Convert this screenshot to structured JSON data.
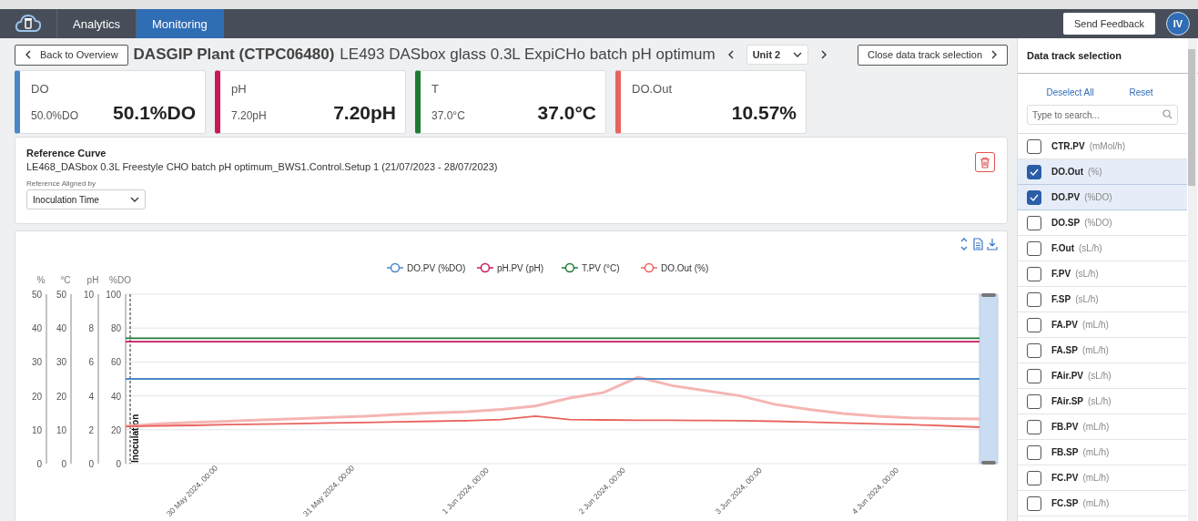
{
  "nav": {
    "tabs": [
      {
        "label": "Analytics",
        "selected": false
      },
      {
        "label": "Monitoring",
        "selected": true
      }
    ],
    "feedback_button": "Send Feedback",
    "avatar": "IV"
  },
  "header": {
    "back_button": "Back to Overview",
    "plant": "DASGIP Plant (CTPC06480)",
    "run": "LE493 DASbox glass 0.3L ExpiCHo batch pH optimum",
    "unit_select": "Unit 2",
    "close_button": "Close data track selection"
  },
  "cards": [
    {
      "label": "DO",
      "setpoint": "50.0%DO",
      "value": "50.1%DO",
      "color": "#4a86c8"
    },
    {
      "label": "pH",
      "setpoint": "7.20pH",
      "value": "7.20pH",
      "color": "#c8185a"
    },
    {
      "label": "T",
      "setpoint": "37.0°C",
      "value": "37.0°C",
      "color": "#1e7b34"
    },
    {
      "label": "DO.Out",
      "value": "10.57%",
      "color": "#e8635e"
    }
  ],
  "reference": {
    "title": "Reference Curve",
    "name": "LE468_DASbox 0.3L Freestyle CHO batch pH optimum_BWS1.Control.Setup 1 (21/07/2023 - 28/07/2023)",
    "aligned_label": "Reference Aligned by",
    "aligned_value": "Inoculation Time"
  },
  "chart": {
    "secondary_axes": [
      {
        "title": "%",
        "ticks": [
          "50",
          "40",
          "30",
          "20",
          "10",
          "0"
        ]
      },
      {
        "title": "°C",
        "ticks": [
          "50",
          "40",
          "30",
          "20",
          "10",
          "0"
        ]
      },
      {
        "title": "pH",
        "ticks": [
          "10",
          "8",
          "6",
          "4",
          "2",
          "0"
        ]
      }
    ],
    "chart_data": {
      "type": "line",
      "ylabel": "%DO",
      "categories": [
        null,
        null,
        "30 May 2024, 00:00",
        null,
        null,
        null,
        "31 May 2024, 00:00",
        null,
        null,
        null,
        "1 Jun 2024, 00:00",
        null,
        null,
        null,
        "2 Jun 2024, 00:00",
        null,
        null,
        null,
        "3 Jun 2024, 00:00",
        null,
        null,
        null,
        "4 Jun 2024, 00:00",
        null,
        null,
        null
      ],
      "yticks": [
        0,
        20,
        40,
        60,
        80,
        100
      ],
      "ylim": [
        0,
        100
      ],
      "grid": true,
      "legend": "top",
      "series": [
        {
          "name": "DO.PV (%DO)",
          "color": "#4a86c8",
          "values": [
            50,
            50,
            50,
            50,
            50,
            50,
            50,
            50,
            50,
            50,
            50,
            50,
            50,
            50,
            50,
            50,
            50,
            50,
            50,
            50,
            50,
            50,
            50,
            50,
            50,
            50
          ]
        },
        {
          "name": "pH.PV (pH)",
          "color": "#c8185a",
          "values": [
            72,
            72,
            72,
            72,
            72,
            72,
            72,
            72,
            72,
            72,
            72,
            72,
            72,
            72,
            72,
            72,
            72,
            72,
            72,
            72,
            72,
            72,
            72,
            72,
            72,
            72
          ]
        },
        {
          "name": "T.PV (°C)",
          "color": "#1e7b34",
          "values": [
            74,
            74,
            74,
            74,
            74,
            74,
            74,
            74,
            74,
            74,
            74,
            74,
            74,
            74,
            74,
            74,
            74,
            74,
            74,
            74,
            74,
            74,
            74,
            74,
            74,
            74
          ]
        },
        {
          "name": "DO.Out (%)",
          "color": "#e8635e",
          "values": [
            22,
            22.3,
            22.6,
            23,
            23.3,
            23.6,
            24,
            24.3,
            24.6,
            25,
            25.3,
            26,
            28,
            26,
            25.8,
            25.6,
            25.6,
            25.5,
            25.3,
            25,
            24.5,
            24,
            23.5,
            23,
            22.3,
            21.5
          ]
        },
        {
          "color": "#f5b5b2",
          "values": [
            22,
            23.5,
            24.3,
            25,
            25.8,
            26.5,
            27.3,
            28,
            29,
            30,
            30.6,
            32,
            34,
            38.7,
            42,
            51,
            46,
            43,
            40,
            35,
            32,
            29.6,
            28,
            27,
            26.6,
            26.3
          ]
        }
      ],
      "annotations": [
        "Inoculation"
      ]
    }
  },
  "track_panel": {
    "title": "Data track selection",
    "deselect_all": "Deselect All",
    "reset": "Reset",
    "search_placeholder": "Type to search...",
    "tracks": [
      {
        "name": "CTR.PV",
        "unit": "(mMol/h)",
        "checked": false
      },
      {
        "name": "DO.Out",
        "unit": "(%)",
        "checked": true
      },
      {
        "name": "DO.PV",
        "unit": "(%DO)",
        "checked": true
      },
      {
        "name": "DO.SP",
        "unit": "(%DO)",
        "checked": false
      },
      {
        "name": "F.Out",
        "unit": "(sL/h)",
        "checked": false
      },
      {
        "name": "F.PV",
        "unit": "(sL/h)",
        "checked": false
      },
      {
        "name": "F.SP",
        "unit": "(sL/h)",
        "checked": false
      },
      {
        "name": "FA.PV",
        "unit": "(mL/h)",
        "checked": false
      },
      {
        "name": "FA.SP",
        "unit": "(mL/h)",
        "checked": false
      },
      {
        "name": "FAir.PV",
        "unit": "(sL/h)",
        "checked": false
      },
      {
        "name": "FAir.SP",
        "unit": "(sL/h)",
        "checked": false
      },
      {
        "name": "FB.PV",
        "unit": "(mL/h)",
        "checked": false
      },
      {
        "name": "FB.SP",
        "unit": "(mL/h)",
        "checked": false
      },
      {
        "name": "FC.PV",
        "unit": "(mL/h)",
        "checked": false
      },
      {
        "name": "FC.SP",
        "unit": "(mL/h)",
        "checked": false
      }
    ]
  }
}
